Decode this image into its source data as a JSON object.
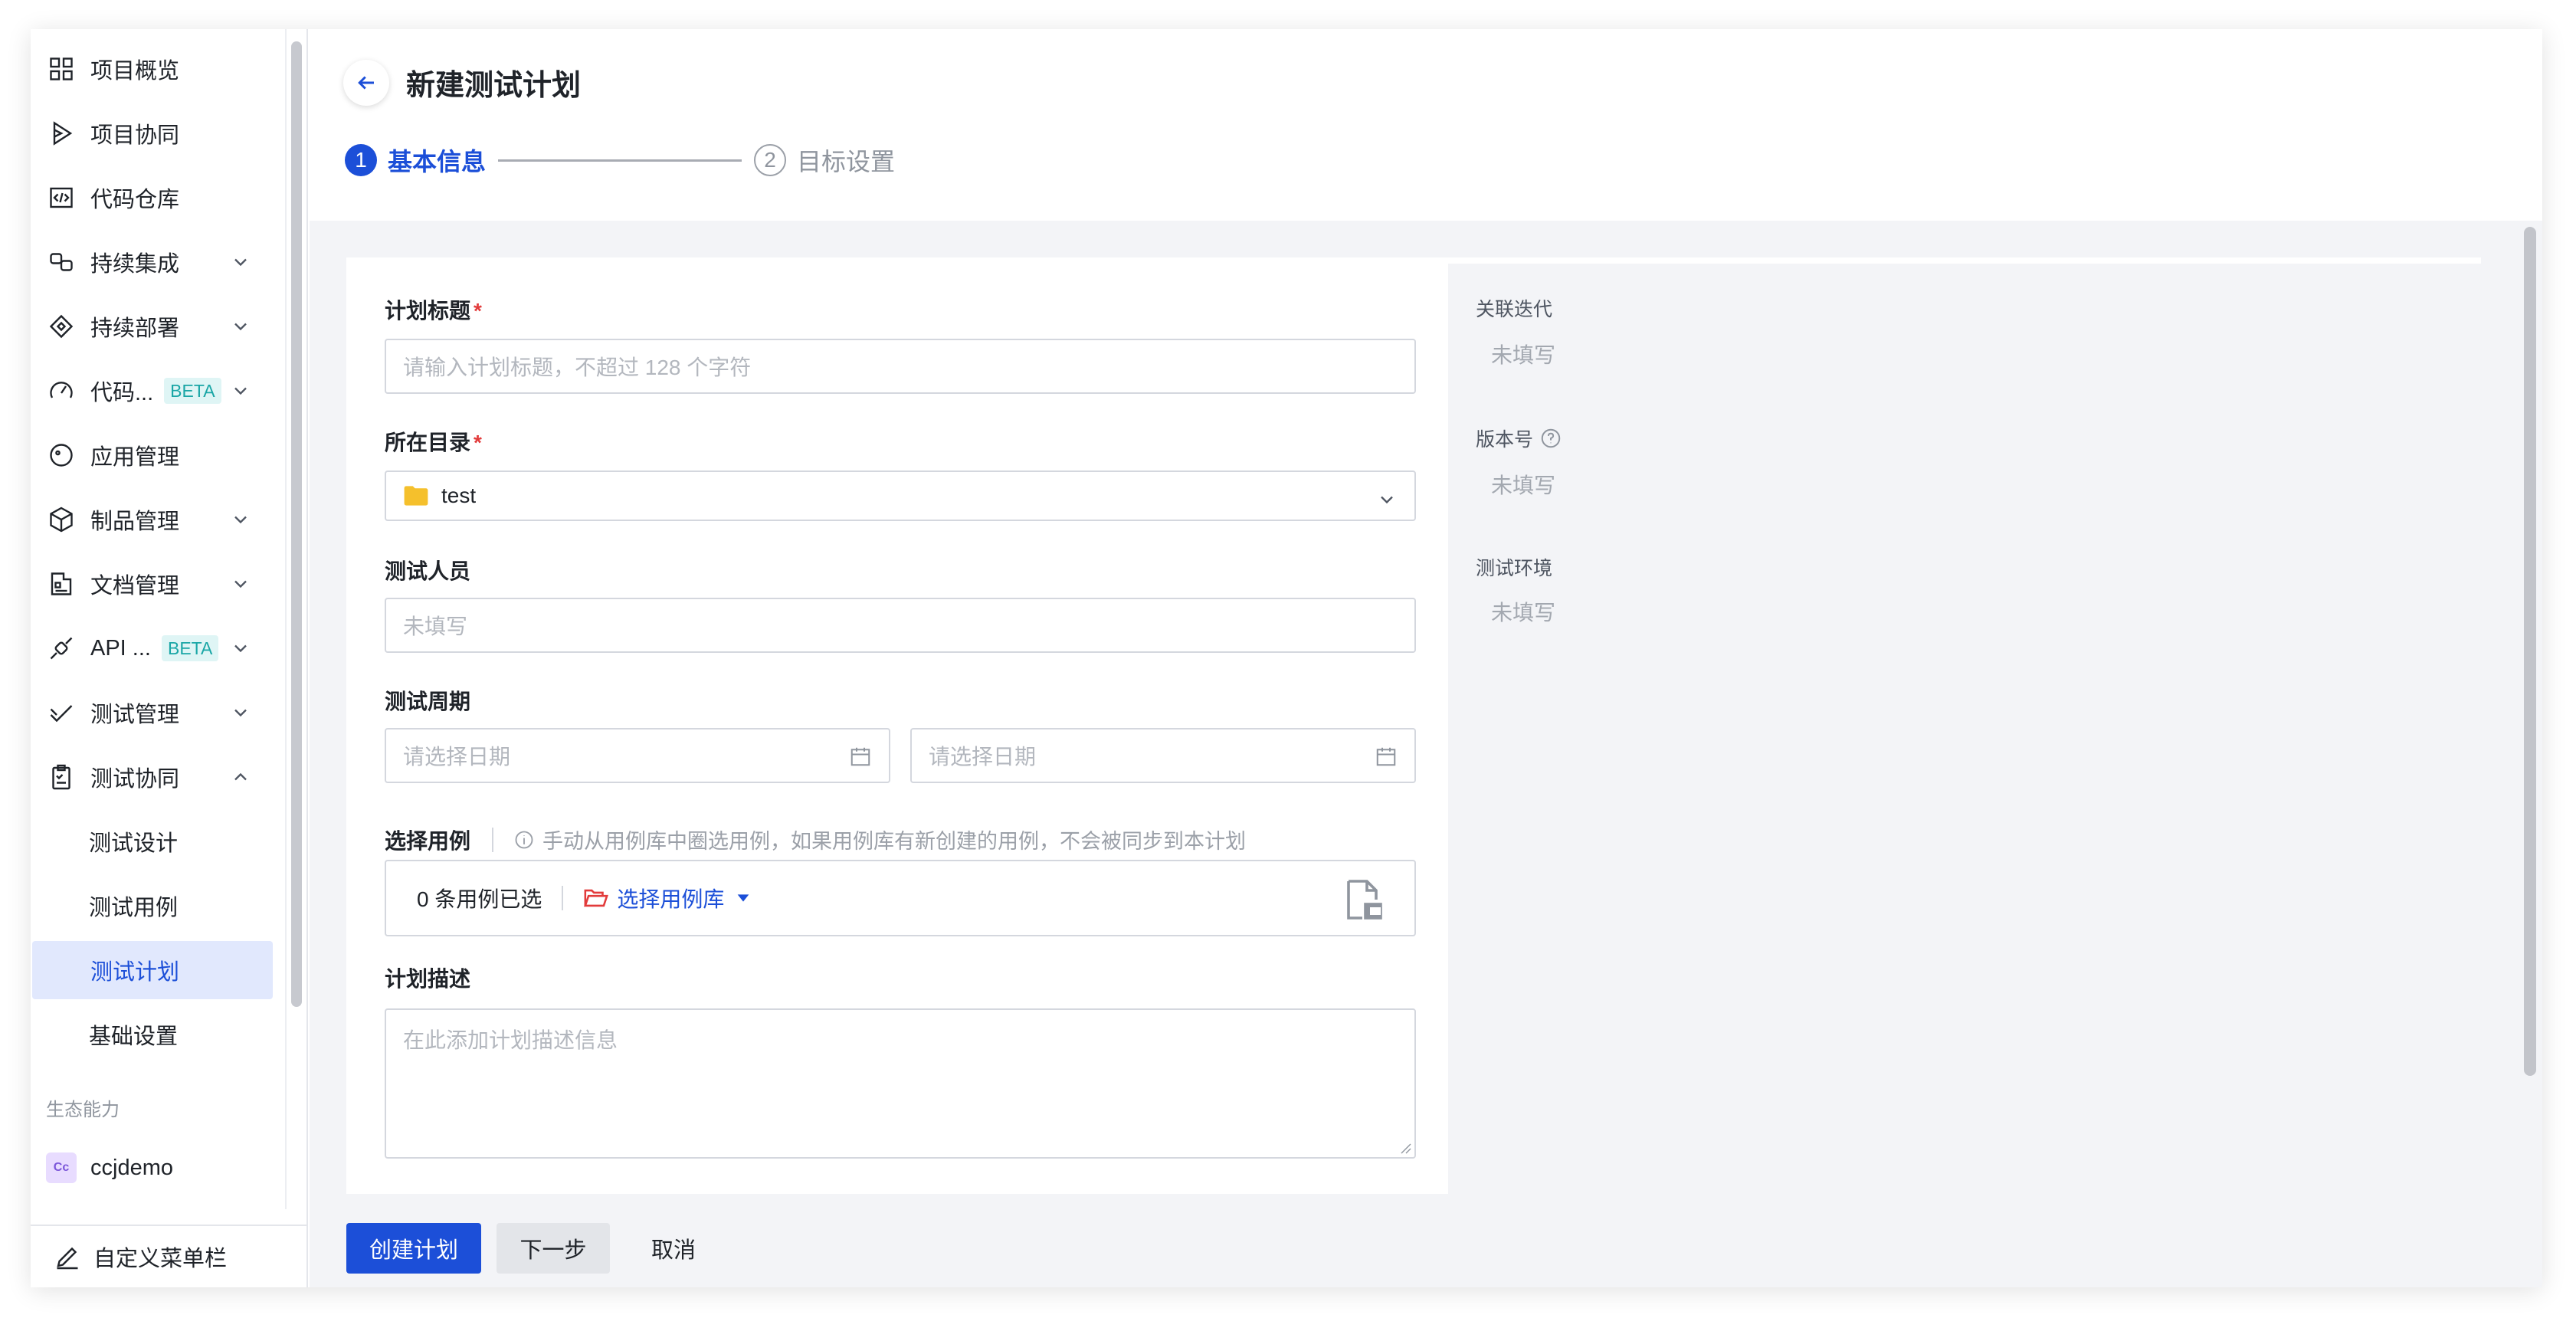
{
  "sidebar": {
    "items": [
      {
        "label": "项目概览",
        "icon": "grid-icon"
      },
      {
        "label": "项目协同",
        "icon": "play-icon"
      },
      {
        "label": "代码仓库",
        "icon": "code-icon"
      },
      {
        "label": "持续集成",
        "icon": "ci-icon"
      },
      {
        "label": "持续部署",
        "icon": "deploy-icon"
      },
      {
        "label": "代码...",
        "icon": "gauge-icon",
        "badge": "BETA"
      },
      {
        "label": "应用管理",
        "icon": "app-icon"
      },
      {
        "label": "制品管理",
        "icon": "box-icon"
      },
      {
        "label": "文档管理",
        "icon": "doc-icon"
      },
      {
        "label": "API ...",
        "icon": "api-icon",
        "badge": "BETA"
      },
      {
        "label": "测试管理",
        "icon": "test-icon"
      },
      {
        "label": "测试协同",
        "icon": "clipboard-icon"
      }
    ],
    "sub_items": [
      {
        "label": "测试设计"
      },
      {
        "label": "测试用例"
      },
      {
        "label": "测试计划"
      },
      {
        "label": "基础设置"
      }
    ],
    "group_title": "生态能力",
    "ecosystem_item": {
      "label": "ccjdemo",
      "logo": "Cc"
    },
    "footer_label": "自定义菜单栏"
  },
  "header": {
    "title": "新建测试计划",
    "steps": [
      {
        "num": "1",
        "label": "基本信息"
      },
      {
        "num": "2",
        "label": "目标设置"
      }
    ]
  },
  "form": {
    "title_label": "计划标题",
    "title_placeholder": "请输入计划标题，不超过 128 个字符",
    "dir_label": "所在目录",
    "dir_value": "test",
    "tester_label": "测试人员",
    "tester_placeholder": "未填写",
    "period_label": "测试周期",
    "start_placeholder": "请选择日期",
    "end_placeholder": "请选择日期",
    "cases_label": "选择用例",
    "cases_hint": "手动从用例库中圈选用例，如果用例库有新创建的用例，不会被同步到本计划",
    "cases_count": "0 条用例已选",
    "cases_link": "选择用例库",
    "desc_label": "计划描述",
    "desc_placeholder": "在此添加计划描述信息",
    "required_mark": "*"
  },
  "side_panel": {
    "iteration_label": "关联迭代",
    "iteration_value": "未填写",
    "version_label": "版本号",
    "version_value": "未填写",
    "env_label": "测试环境",
    "env_value": "未填写"
  },
  "footer": {
    "create_label": "创建计划",
    "next_label": "下一步",
    "cancel_label": "取消"
  },
  "colors": {
    "primary": "#1c4fd8",
    "active_bg": "#e1e8fd",
    "required": "#e23b3b",
    "beta_bg": "#dff5f5",
    "beta_text": "#1aa6a6",
    "folder": "#f5c02c",
    "link_folder": "#e23b3b"
  }
}
